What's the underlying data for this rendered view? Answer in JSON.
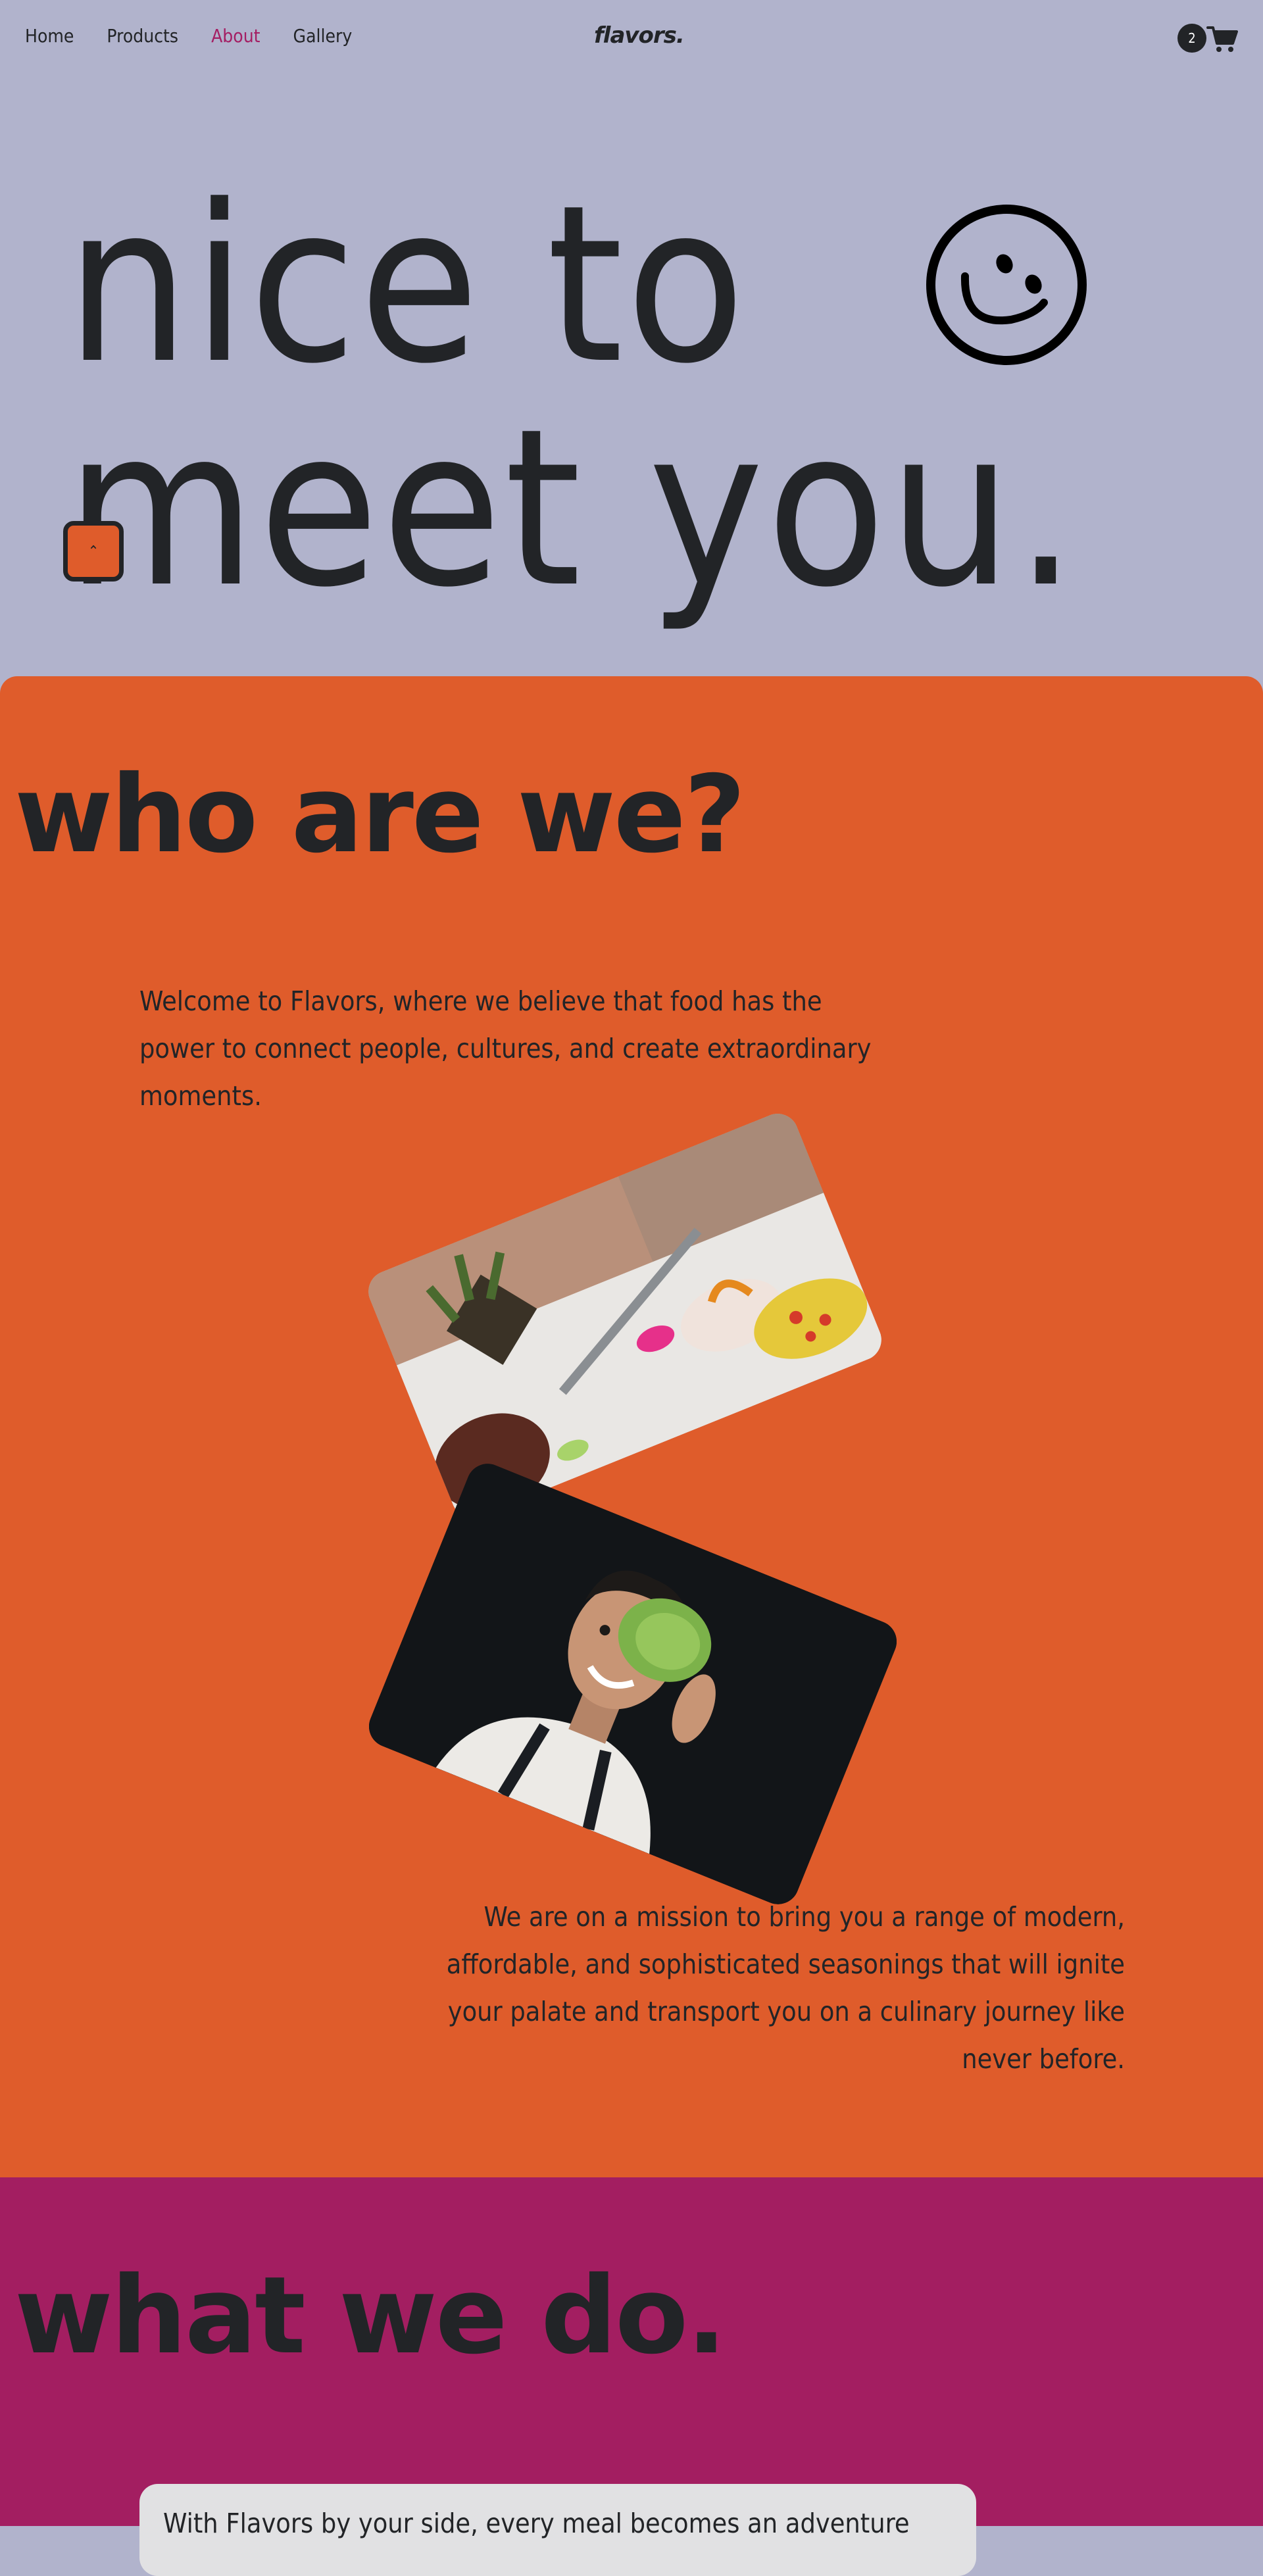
{
  "nav": {
    "links": [
      {
        "label": "Home"
      },
      {
        "label": "Products"
      },
      {
        "label": "About"
      },
      {
        "label": "Gallery"
      }
    ],
    "active_index": 2,
    "logo": "flavors.",
    "cart_count": "2",
    "cart_icon": "cart-icon"
  },
  "hero": {
    "line1": "nice to",
    "line2": "meet you.",
    "smiley_icon": "smiley-wink-icon",
    "scroll_top_icon": "chevron-up-icon"
  },
  "about": {
    "title": "who are we?",
    "paragraph1": "Welcome to Flavors, where we believe that food has the power to connect people, cultures, and create extraordinary moments.",
    "paragraph2": "We are on a mission to bring you a range of modern, affordable, and sophisticated seasonings that will ignite your palate and transport you on a culinary journey like never before."
  },
  "what": {
    "title": "what we do.",
    "card_text": "With Flavors by your side, every meal becomes an adventure"
  },
  "colors": {
    "hero_bg": "#b1b3cc",
    "about_bg": "#df5c2b",
    "what_bg": "#a31e61",
    "text_dark": "#222427",
    "active_link": "#a41e63"
  }
}
